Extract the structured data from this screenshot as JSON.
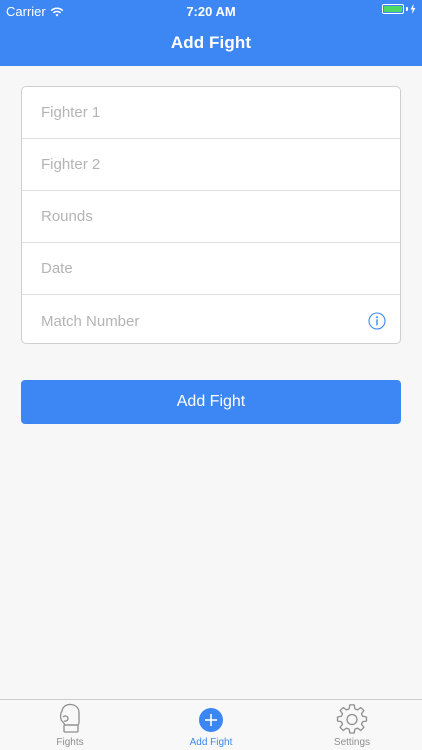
{
  "status_bar": {
    "carrier": "Carrier",
    "time": "7:20 AM"
  },
  "nav": {
    "title": "Add Fight"
  },
  "form": {
    "fields": [
      {
        "placeholder": "Fighter 1",
        "value": ""
      },
      {
        "placeholder": "Fighter 2",
        "value": ""
      },
      {
        "placeholder": "Rounds",
        "value": ""
      },
      {
        "placeholder": "Date",
        "value": ""
      },
      {
        "placeholder": "Match Number",
        "value": ""
      }
    ]
  },
  "actions": {
    "add_fight_label": "Add Fight"
  },
  "tab_bar": {
    "tabs": [
      {
        "label": "Fights",
        "icon": "boxing-glove-icon",
        "active": false
      },
      {
        "label": "Add Fight",
        "icon": "plus-circle-icon",
        "active": true
      },
      {
        "label": "Settings",
        "icon": "gear-icon",
        "active": false
      }
    ]
  },
  "colors": {
    "accent": "#3d87f5",
    "battery": "#4cd964",
    "tab_inactive": "#8e8e8e"
  }
}
